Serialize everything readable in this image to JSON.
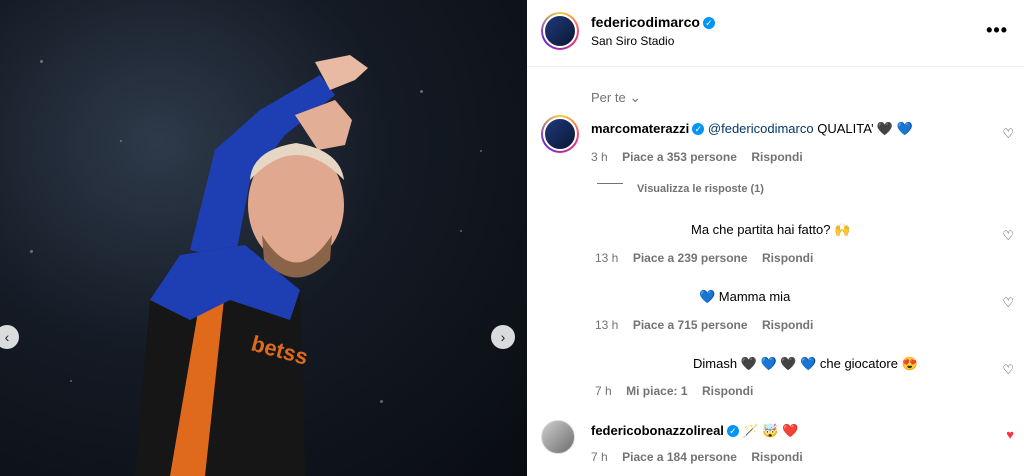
{
  "post": {
    "author": "federicodimarco",
    "location": "San Siro Stadio",
    "more_label": "•••"
  },
  "sort": {
    "label": "Per te",
    "chevron": "⌄"
  },
  "comments": [
    {
      "username": "marcomaterazzi",
      "mention": "@federicodimarco",
      "text": "QUALITA’ 🖤 💙",
      "time": "3 h",
      "likes": "Piace a 353 persone",
      "reply": "Rispondi",
      "view_replies": "Visualizza le risposte (1)"
    },
    {
      "text": "Ma che partita hai fatto? 🙌",
      "time": "13 h",
      "likes": "Piace a 239 persone",
      "reply": "Rispondi"
    },
    {
      "text": "💙 Mamma mia",
      "time": "13 h",
      "likes": "Piace a 715 persone",
      "reply": "Rispondi"
    },
    {
      "text": "Dimash 🖤 💙 🖤 💙 che giocatore 😍",
      "time": "7 h",
      "likes": "Mi piace: 1",
      "reply": "Rispondi"
    },
    {
      "username": "federicobonazzolireal",
      "text": "🪄 🤯 ❤️",
      "time": "7 h",
      "likes": "Piace a 184 persone",
      "reply": "Rispondi"
    }
  ],
  "icons": {
    "heart_outline": "♡",
    "heart_filled": "♥",
    "verified": "✓",
    "prev": "‹",
    "next": "›"
  },
  "colors": {
    "verified": "#0095f6",
    "liked": "#ff3040"
  }
}
